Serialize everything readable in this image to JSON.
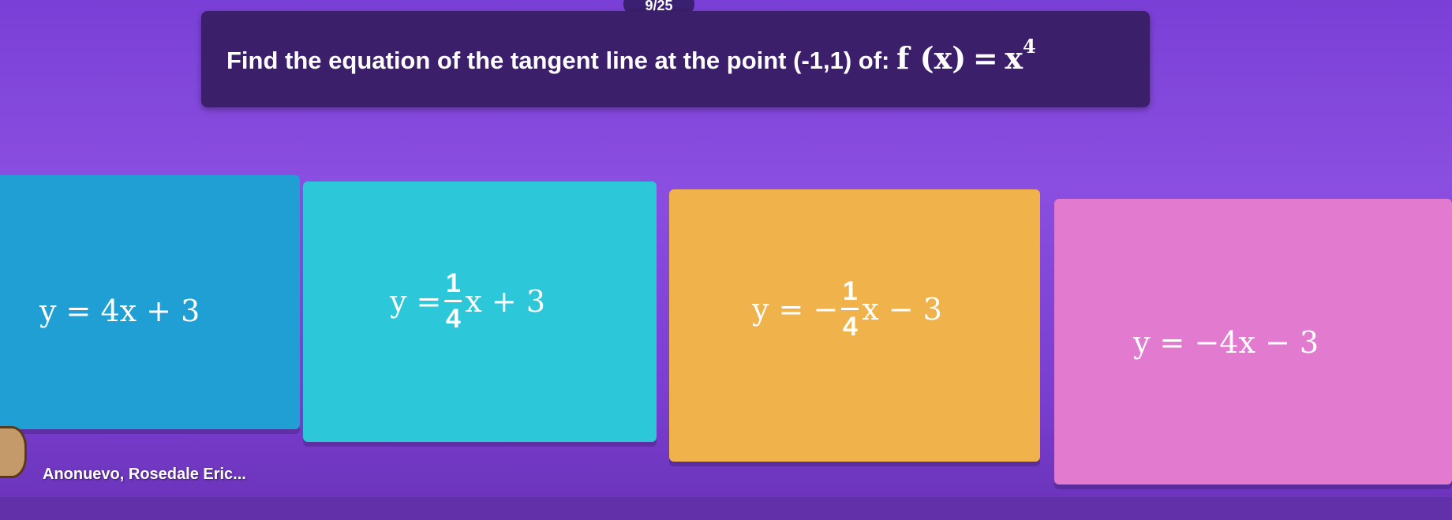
{
  "header": {
    "counter": "9/25"
  },
  "question": {
    "prefix": "Find the equation of the tangent line at the point (-1,1) of:",
    "function_lhs": "f (x)",
    "equals": "=",
    "base": "x",
    "exponent": "4"
  },
  "answers": [
    {
      "text": "y = 4x + 3",
      "color": "#1f9fd4"
    },
    {
      "lhs": "y =",
      "numerator": "1",
      "denominator": "4",
      "rest": "x + 3",
      "color": "#2cc7d8"
    },
    {
      "lhs": "y = −",
      "numerator": "1",
      "denominator": "4",
      "rest": "x − 3",
      "color": "#f0b24a"
    },
    {
      "text": "y = −4x − 3",
      "color": "#e27ad0"
    }
  ],
  "author": {
    "name": "Anonuevo, Rosedale Eric..."
  }
}
